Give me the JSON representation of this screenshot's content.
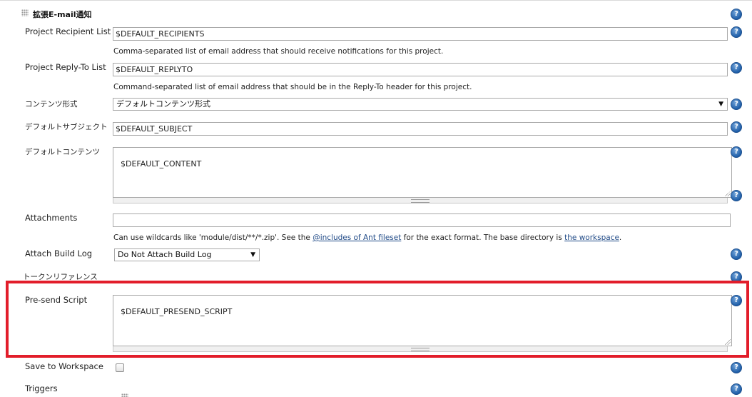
{
  "section": {
    "title": "拡張E-mail通知"
  },
  "fields": {
    "recipients": {
      "label": "Project Recipient List",
      "value": "$DEFAULT_RECIPIENTS",
      "help": "Comma-separated list of email address that should receive notifications for this project."
    },
    "replyto": {
      "label": "Project Reply-To List",
      "value": "$DEFAULT_REPLYTO",
      "help": "Command-separated list of email address that should be in the Reply-To header for this project."
    },
    "content_type": {
      "label": "コンテンツ形式",
      "value": "デフォルトコンテンツ形式"
    },
    "subject": {
      "label": "デフォルトサブジェクト",
      "value": "$DEFAULT_SUBJECT"
    },
    "content": {
      "label": "デフォルトコンテンツ",
      "value": "$DEFAULT_CONTENT"
    },
    "attachments": {
      "label": "Attachments",
      "value": "",
      "desc_pre": "Can use wildcards like 'module/dist/**/*.zip'. See the ",
      "desc_link1": "@includes of Ant fileset",
      "desc_mid": " for the exact format. The base directory is ",
      "desc_link2": "the workspace",
      "desc_post": "."
    },
    "attach_build_log": {
      "label": "Attach Build Log",
      "value": "Do Not Attach Build Log"
    },
    "token_reference": {
      "label": "トークンリファレンス"
    },
    "presend_script": {
      "label": "Pre-send Script",
      "value": "$DEFAULT_PRESEND_SCRIPT"
    },
    "save_to_workspace": {
      "label": "Save to Workspace",
      "checked": false
    },
    "triggers": {
      "label": "Triggers"
    }
  },
  "icons": {
    "help": "help-icon",
    "grip": "drag-grip-icon"
  },
  "help_glyph": "?",
  "select_arrow": "▼",
  "colors": {
    "highlight": "#e21d2a",
    "help": "#1f5ea8",
    "link": "#204a87"
  }
}
